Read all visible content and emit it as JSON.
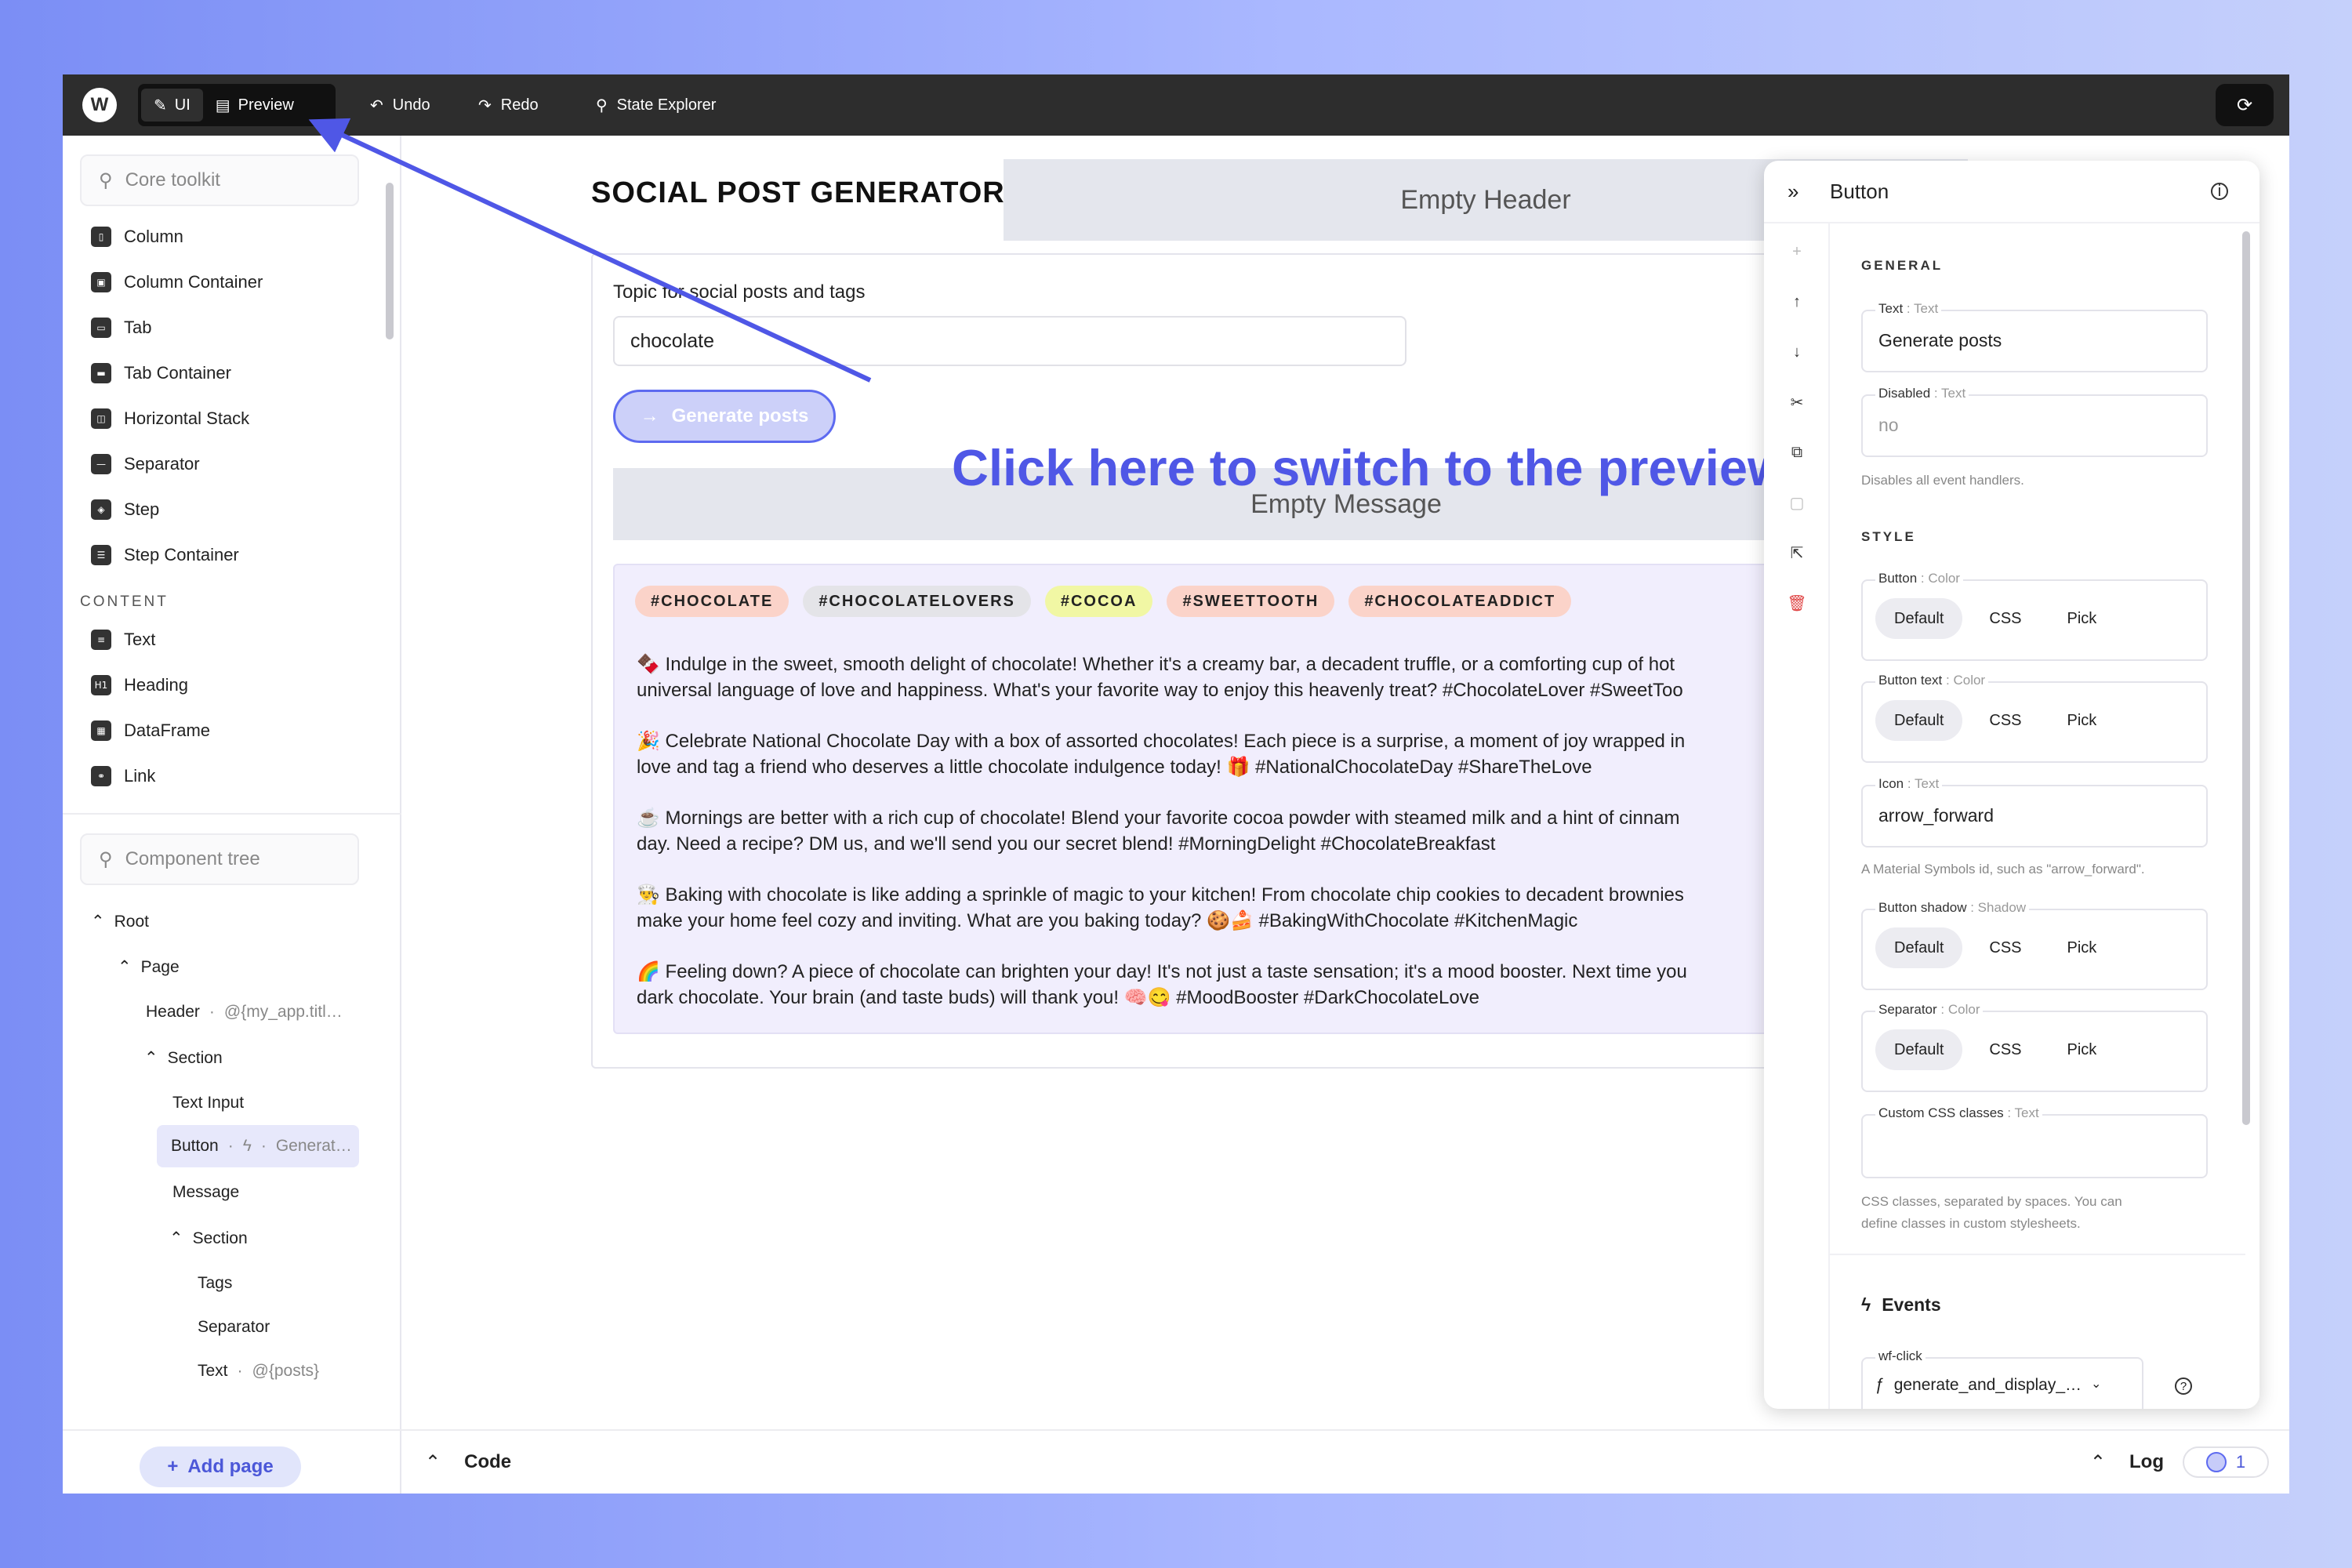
{
  "toolbar": {
    "logo": "W",
    "ui_label": "UI",
    "preview_label": "Preview",
    "undo_label": "Undo",
    "redo_label": "Redo",
    "state_explorer_label": "State Explorer"
  },
  "sidebar": {
    "toolkit_search_placeholder": "Core toolkit",
    "layout_items": [
      "Column",
      "Column Container",
      "Tab",
      "Tab Container",
      "Horizontal Stack",
      "Separator",
      "Step",
      "Step Container"
    ],
    "content_heading": "CONTENT",
    "content_items": [
      "Text",
      "Heading",
      "DataFrame",
      "Link"
    ],
    "tree_search_placeholder": "Component tree",
    "tree": {
      "root": "Root",
      "page": "Page",
      "header": "Header",
      "header_binding": "@{my_app.titl…",
      "section": "Section",
      "text_input": "Text Input",
      "button": "Button",
      "button_binding": "Generat…",
      "message": "Message",
      "section2": "Section",
      "tags": "Tags",
      "separator": "Separator",
      "text": "Text",
      "text_binding": "@{posts}"
    },
    "add_page_label": "Add page"
  },
  "canvas": {
    "app_title": "SOCIAL POST GENERATOR",
    "empty_header": "Empty Header",
    "input_label": "Topic for social posts and tags",
    "input_value": "chocolate",
    "generate_button": "Generate posts",
    "empty_message": "Empty Message",
    "tags": [
      {
        "label": "#CHOCOLATE",
        "color": "#fbd3c9"
      },
      {
        "label": "#CHOCOLATELOVERS",
        "color": "#e4e4e8"
      },
      {
        "label": "#COCOA",
        "color": "#f1f7a4"
      },
      {
        "label": "#SWEETTOOTH",
        "color": "#fbd3c9"
      },
      {
        "label": "#CHOCOLATEADDICT",
        "color": "#fbd3c9"
      }
    ],
    "posts": [
      [
        "🍫 Indulge in the sweet, smooth delight of chocolate! Whether it's a creamy bar, a decadent truffle, or a comforting cup of hot",
        "universal language of love and happiness. What's your favorite way to enjoy this heavenly treat? #ChocolateLover #SweetToo"
      ],
      [
        "🎉 Celebrate National Chocolate Day with a box of assorted chocolates! Each piece is a surprise, a moment of joy wrapped in",
        "love and tag a friend who deserves a little chocolate indulgence today! 🎁 #NationalChocolateDay #ShareTheLove"
      ],
      [
        "☕ Mornings are better with a rich cup of chocolate! Blend your favorite cocoa powder with steamed milk and a hint of cinnam",
        "day. Need a recipe? DM us, and we'll send you our secret blend! #MorningDelight #ChocolateBreakfast"
      ],
      [
        "👨‍🍳 Baking with chocolate is like adding a sprinkle of magic to your kitchen! From chocolate chip cookies to decadent brownies",
        "make your home feel cozy and inviting. What are you baking today? 🍪🍰 #BakingWithChocolate #KitchenMagic"
      ],
      [
        "🌈 Feeling down? A piece of chocolate can brighten your day! It's not just a taste sensation; it's a mood booster. Next time you",
        "dark chocolate. Your brain (and taste buds) will thank you! 🧠😋 #MoodBooster #DarkChocolateLove"
      ]
    ],
    "callout": "Click here to switch to the preview",
    "code_label": "Code",
    "log_label": "Log",
    "log_count": "1"
  },
  "panel": {
    "title": "Button",
    "general_heading": "GENERAL",
    "text_label": "Text",
    "text_type": ": Text",
    "text_value": "Generate posts",
    "disabled_label": "Disabled",
    "disabled_type": ": Text",
    "disabled_value": "no",
    "disabled_hint": "Disables all event handlers.",
    "style_heading": "STYLE",
    "button_label": "Button",
    "button_type": ": Color",
    "buttontext_label": "Button text",
    "buttontext_type": ": Color",
    "icon_label": "Icon",
    "icon_type": ": Text",
    "icon_value": "arrow_forward",
    "icon_hint": "A Material Symbols id, such as \"arrow_forward\".",
    "shadow_label": "Button shadow",
    "shadow_type": ": Shadow",
    "separator_label": "Separator",
    "separator_type": ": Color",
    "css_label": "Custom CSS classes",
    "css_type": ": Text",
    "css_hint_1": "CSS classes, separated by spaces. You can",
    "css_hint_2": "define classes in custom stylesheets.",
    "opt_default": "Default",
    "opt_css": "CSS",
    "opt_pick": "Pick",
    "events_heading": "Events",
    "event_name": "wf-click",
    "event_handler": "generate_and_display_…"
  },
  "colors": {
    "accent": "#4f57e6",
    "topbar": "#2d2d2d",
    "posts_bg": "#f1eefd"
  }
}
